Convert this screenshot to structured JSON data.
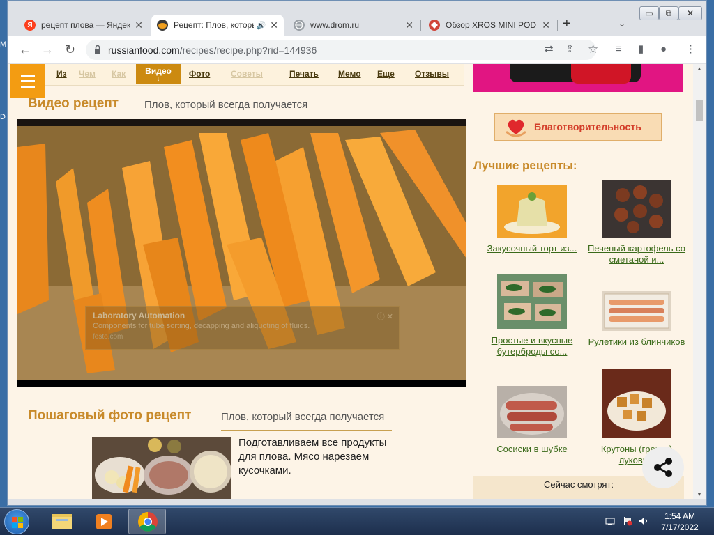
{
  "desktop": {
    "frag_top": "M",
    "frag_mid": "D"
  },
  "window": {
    "btn_min": "▭",
    "btn_max": "⧉",
    "btn_close": "✕"
  },
  "tabs": [
    {
      "title": "рецепт плова — Яндекс",
      "favicon_letter": "Я",
      "favicon_color": "#fc3f1d",
      "close": "✕"
    },
    {
      "title": "Рецепт: Плов, который",
      "favicon_color": "#f0a020",
      "speaker": "🔊",
      "close": "✕"
    },
    {
      "title": "www.drom.ru",
      "favicon_color": "#9aa0a6",
      "close": "✕"
    },
    {
      "title": "Обзор XROS MINI POD",
      "favicon_color": "#d0453a",
      "close": "✕"
    }
  ],
  "newtab": "+",
  "tabdrop": "⌄",
  "toolbar": {
    "back": "←",
    "forward": "→",
    "reload": "↻",
    "url_host": "russianfood.com",
    "url_path": "/recipes/recipe.php?rid=144936",
    "icons": {
      "translate": "⇄",
      "share": "⇪",
      "star": "☆",
      "media": "≡",
      "sidepanel": "▮",
      "profile": "●",
      "menu": "⋮"
    }
  },
  "nav": {
    "items": [
      "Из",
      "Чем",
      "Как",
      "Видео",
      "Фото",
      "Советы",
      "Печать",
      "Мемо",
      "Еще",
      "Отзывы"
    ],
    "video_arrow": "↓"
  },
  "main": {
    "video_heading": "Видео рецепт",
    "video_subtitle": "Плов, который всегда получается",
    "ad": {
      "title": "Laboratory Automation",
      "desc": "Components for tube sorting, decapping and aliquoting of fluids.",
      "url": "festo.com",
      "icons": "ⓘ ✕"
    },
    "photo_heading": "Пошаговый фото рецепт",
    "photo_subtitle": "Плов, который всегда получается",
    "step_text": "Подготавливаем все продукты для плова. Мясо нарезаем кусочками."
  },
  "sidebar": {
    "charity": "Благотворительность",
    "best_title": "Лучшие рецепты:",
    "recipes": [
      "Закусочный торт из...",
      "Печеный картофель со сметаной и...",
      "Простые и вкусные бутерброды со...",
      "Рулетики из блинчиков",
      "Сосиски в шубке",
      "Крутоны (гренки) луковые"
    ],
    "watching": "Сейчас смотрят:"
  },
  "scroll": {
    "up": "▲",
    "down": "▼"
  },
  "taskbar": {
    "time": "1:54 AM",
    "date": "7/17/2022"
  }
}
